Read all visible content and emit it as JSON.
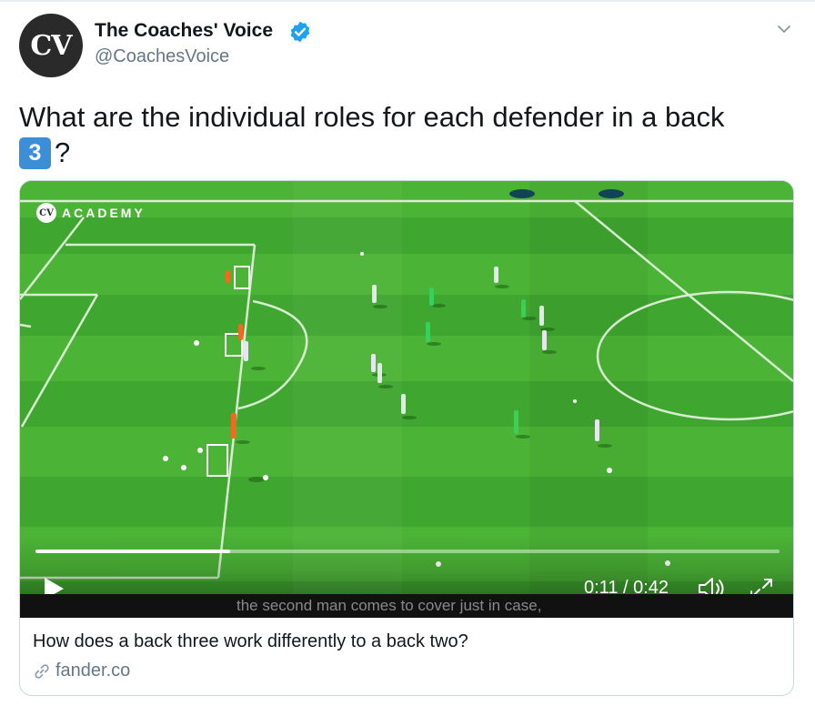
{
  "tweet": {
    "avatar_text": "CV",
    "author_name": "The Coaches' Voice",
    "handle": "@CoachesVoice",
    "text_line1": "What are the individual roles for each defender in a back",
    "keycap": "3",
    "text_line2_suffix": "?"
  },
  "card": {
    "video": {
      "brand_logo": "CV",
      "brand_text": "ACADEMY",
      "progress": 0.262,
      "time": "0:11 / 0:42",
      "subtitle": "the second man comes to cover just in case,"
    },
    "title": "How does a back three work differently to a back two?",
    "link": "fander.co"
  },
  "icons": {
    "verified": "verified-badge-icon",
    "caret": "chevron-down-icon",
    "play": "play-icon",
    "volume": "volume-icon",
    "fullscreen": "fullscreen-icon",
    "link": "link-icon"
  },
  "colors": {
    "verified_blue": "#1da1f2",
    "keycap_blue": "#3b8fd6",
    "pitch_green": "#3fa62f",
    "pitch_green_light": "#52b83a",
    "muted_text": "#657786"
  }
}
